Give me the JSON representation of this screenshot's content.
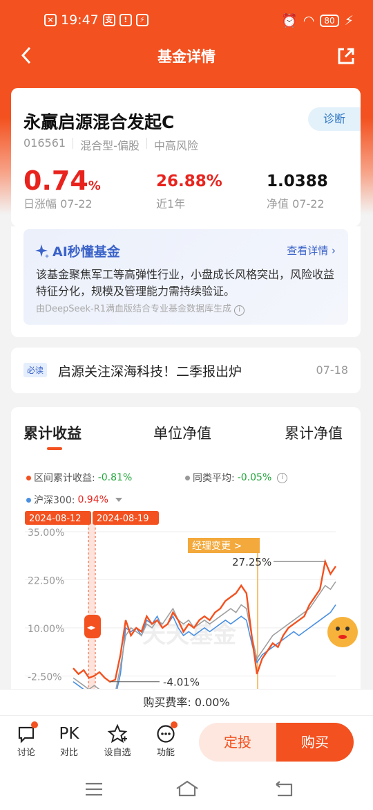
{
  "status_bar": {
    "time": "19:47",
    "battery": "80"
  },
  "nav": {
    "title": "基金详情"
  },
  "fund": {
    "name": "永赢启源混合发起C",
    "diagnose": "诊断",
    "code": "016561",
    "type": "混合型-偏股",
    "risk": "中高风险",
    "daily_change_value": "0.74",
    "daily_change_unit": "%",
    "daily_change_label": "日涨幅 07-22",
    "year_return": "26.88%",
    "year_label": "近1年",
    "nav_value": "1.0388",
    "nav_label": "净值 07-22"
  },
  "ai": {
    "title": "AI秒懂基金",
    "more": "查看详情",
    "text": "该基金聚焦军工等高弹性行业，小盘成长风格突出，风险收益特征分化，规模及管理能力需持续验证。",
    "footer": "由DeepSeek-R1满血版结合专业基金数据库生成"
  },
  "news": {
    "tag": "必读",
    "title": "启源关注深海科技！二季报出炉",
    "date": "07-18"
  },
  "chart": {
    "tabs": [
      "累计收益",
      "单位净值",
      "累计净值"
    ],
    "legend": {
      "fund_label": "区间累计收益:",
      "fund_value": "-0.81%",
      "peer_label": "同类平均:",
      "peer_value": "-0.05%",
      "index_label": "沪深300:",
      "index_value": "0.94%"
    },
    "date_start": "2024-08-12",
    "date_end": "2024-08-19",
    "manager_change": "经理变更 >",
    "max_label": "27.25%",
    "min_label": "-4.01%",
    "watermark": "天天基金",
    "colors": {
      "fund": "#f3511f",
      "peer": "#a0a0a0",
      "index": "#4a90e2"
    }
  },
  "chart_data": {
    "type": "line",
    "yticks": [
      "35.00%",
      "22.50%",
      "10.00%",
      "-2.50%"
    ],
    "ylim": [
      -10,
      35
    ],
    "x": [
      0,
      2,
      4,
      6,
      8,
      10,
      12,
      14,
      16,
      18,
      20,
      22,
      24,
      26,
      28,
      30,
      32,
      34,
      36,
      38,
      40,
      42,
      44,
      46,
      48,
      50,
      52,
      54,
      56,
      58,
      60,
      62,
      64,
      66,
      68,
      70,
      72,
      74,
      76,
      78,
      80,
      82,
      84,
      86,
      88,
      90,
      92,
      94,
      96,
      98,
      100
    ],
    "series": [
      {
        "values": [
          -0.5,
          -2,
          -1,
          -3,
          -2.5,
          -1.5,
          -3,
          -4.01,
          -3.5,
          3,
          12,
          8,
          10,
          9,
          13,
          11,
          12,
          10,
          11,
          14,
          12,
          9,
          11,
          10,
          12,
          13,
          12,
          14,
          15,
          17,
          18,
          19,
          21,
          19,
          8,
          -2,
          2,
          4,
          6,
          5,
          8,
          10,
          11,
          12,
          13,
          16,
          18,
          20,
          27.25,
          24,
          26
        ]
      },
      {
        "values": [
          -3,
          -4,
          -5,
          -6,
          -5,
          -6,
          -7,
          -8,
          -7,
          0,
          8,
          10,
          9,
          8,
          11,
          10,
          12,
          11,
          13,
          15,
          12,
          11,
          12,
          10,
          11,
          12,
          11,
          12,
          13,
          14,
          15,
          14,
          16,
          15,
          8,
          2,
          4,
          6,
          8,
          9,
          10,
          11,
          12,
          13,
          14,
          15,
          17,
          19,
          21,
          20,
          22
        ]
      },
      {
        "values": [
          -4,
          -5,
          -6,
          -7,
          -6,
          -7,
          -8,
          -9,
          -8,
          -2,
          10,
          9,
          10,
          8,
          12,
          11,
          13,
          10,
          11,
          13,
          10,
          8,
          9,
          8,
          9,
          10,
          9,
          10,
          11,
          12,
          11,
          12,
          13,
          12,
          6,
          1,
          3,
          4,
          5,
          6,
          7,
          8,
          9,
          8,
          9,
          10,
          11,
          12,
          13,
          14,
          16
        ]
      }
    ]
  },
  "fee": {
    "text": "购买费率: 0.00%"
  },
  "bottom": {
    "items": [
      "讨论",
      "对比",
      "设自选",
      "功能"
    ],
    "pk": "PK",
    "dingtou": "定投",
    "buy": "购买"
  }
}
